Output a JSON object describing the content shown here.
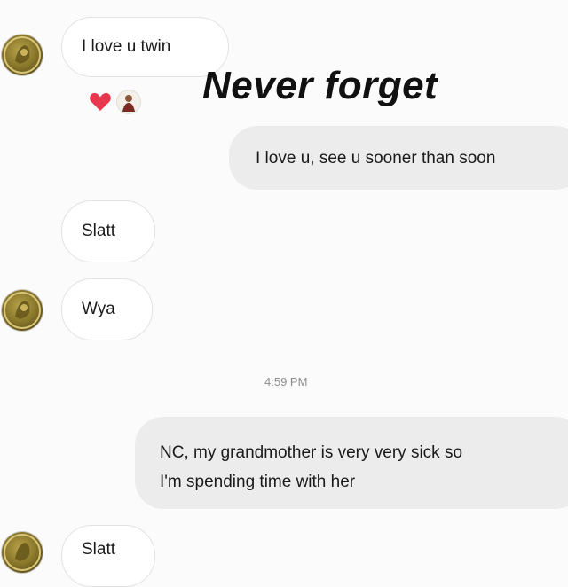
{
  "overlay_caption": "Never forget",
  "messages": [
    {
      "id": "m1",
      "text": "I love u twin",
      "sender": "other"
    },
    {
      "id": "m2",
      "text": "I love u, see u sooner than soon",
      "sender": "me"
    },
    {
      "id": "m3",
      "text": "Slatt",
      "sender": "other"
    },
    {
      "id": "m4",
      "text": "Wya",
      "sender": "other"
    },
    {
      "id": "m5",
      "text": "NC, my grandmother is very very sick so",
      "text2": "I'm spending time with her",
      "sender": "me"
    },
    {
      "id": "m6",
      "text": "Slatt",
      "sender": "other"
    }
  ],
  "timestamp": "4:59 PM",
  "reactions": {
    "heart_color": "#e8384f",
    "icons": [
      "heart-icon",
      "reactor-avatar-icon"
    ]
  },
  "colors": {
    "background": "#fbfbfb",
    "incoming_bubble": "#ffffff",
    "outgoing_bubble": "#ececec"
  }
}
